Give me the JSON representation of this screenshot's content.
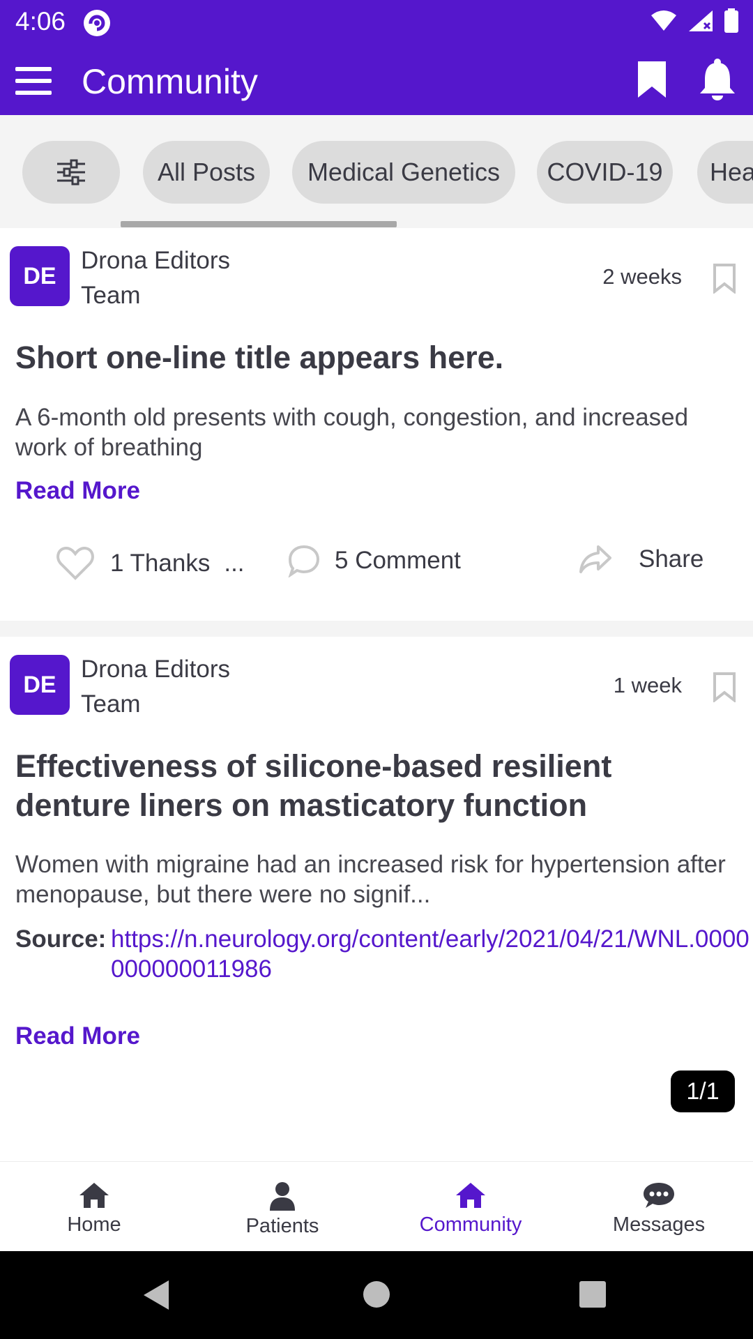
{
  "status_bar": {
    "time": "4:06"
  },
  "header": {
    "title": "Community"
  },
  "filters": {
    "chips": [
      "All Posts",
      "Medical Genetics",
      "COVID-19",
      "Hea"
    ]
  },
  "posts": [
    {
      "avatar_initials": "DE",
      "author_line1": "Drona Editors",
      "author_line2": "Team",
      "time_ago": "2 weeks",
      "title": "Short one-line title appears here.",
      "body": "A 6-month old presents with cough, congestion, and increased work of breathing",
      "read_more": "Read More",
      "thanks": "1 Thanks",
      "thanks_more": "...",
      "comments": "5 Comment",
      "share": "Share"
    },
    {
      "avatar_initials": "DE",
      "author_line1": "Drona Editors",
      "author_line2": "Team",
      "time_ago": "1 week",
      "title": "Effectiveness of silicone-based resilient denture liners on masticatory function",
      "body": "Women with migraine had an increased risk for hypertension after menopause, but there were no signif...",
      "source_label": "Source:",
      "source_url": "https://n.neurology.org/content/early/2021/04/21/WNL.0000000000011986",
      "read_more": "Read More"
    }
  ],
  "pagination": {
    "label": "1/1"
  },
  "bottom_nav": {
    "items": [
      {
        "label": "Home",
        "icon": "home-icon"
      },
      {
        "label": "Patients",
        "icon": "person-icon"
      },
      {
        "label": "Community",
        "icon": "community-home-icon",
        "active": true
      },
      {
        "label": "Messages",
        "icon": "chat-bubble-icon"
      }
    ]
  },
  "colors": {
    "primary": "#5517cc",
    "chip_bg": "#dcdcdc",
    "text": "#3a3a44"
  }
}
